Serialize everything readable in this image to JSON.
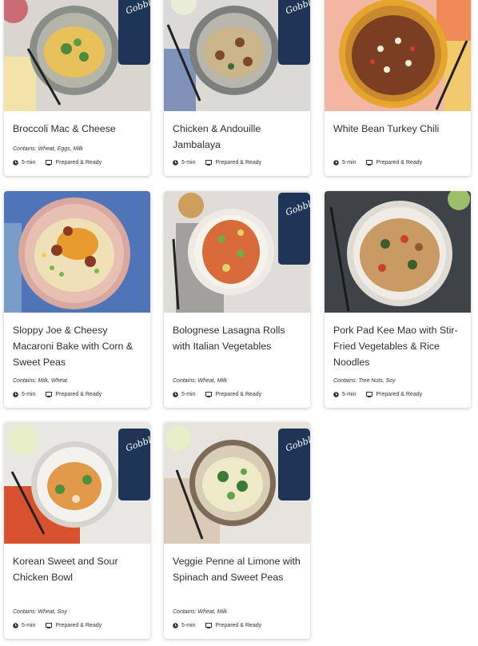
{
  "brand": {
    "box_logo": "Gobble"
  },
  "colors": {
    "accent_box": "#1f3558",
    "card_bg": "#ffffff",
    "text": "#2f2f2f"
  },
  "icons": {
    "time": "clock-icon",
    "prep": "prepared-ready-icon"
  },
  "cards": [
    {
      "title": "Broccoli Mac & Cheese",
      "contains": "Contains: Wheat, Eggs, Milk",
      "time": "5-min",
      "prep": "Prepared & Ready"
    },
    {
      "title": "Chicken & Andouille Jambalaya",
      "contains": "",
      "time": "5-min",
      "prep": "Prepared & Ready"
    },
    {
      "title": "White Bean Turkey Chili",
      "contains": "",
      "time": "5-min",
      "prep": "Prepared & Ready"
    },
    {
      "title": "Sloppy Joe & Cheesy Macaroni Bake with Corn & Sweet Peas",
      "contains": "Contains: Milk, Wheat",
      "time": "5-min",
      "prep": "Prepared & Ready"
    },
    {
      "title": "Bolognese Lasagna Rolls with Italian Vegetables",
      "contains": "Contains: Wheat, Milk",
      "time": "5-min",
      "prep": "Prepared & Ready"
    },
    {
      "title": "Pork Pad Kee Mao with Stir-Fried Vegetables & Rice Noodles",
      "contains": "Contains: Tree Nuts, Soy",
      "time": "5-min",
      "prep": "Prepared & Ready"
    },
    {
      "title": "Korean Sweet and Sour Chicken Bowl",
      "contains": "Contains: Wheat, Soy",
      "time": "5-min",
      "prep": "Prepared & Ready"
    },
    {
      "title": "Veggie Penne al Limone with Spinach and Sweet Peas",
      "contains": "Contains: Wheat, Milk",
      "time": "5-min",
      "prep": "Prepared & Ready"
    }
  ]
}
